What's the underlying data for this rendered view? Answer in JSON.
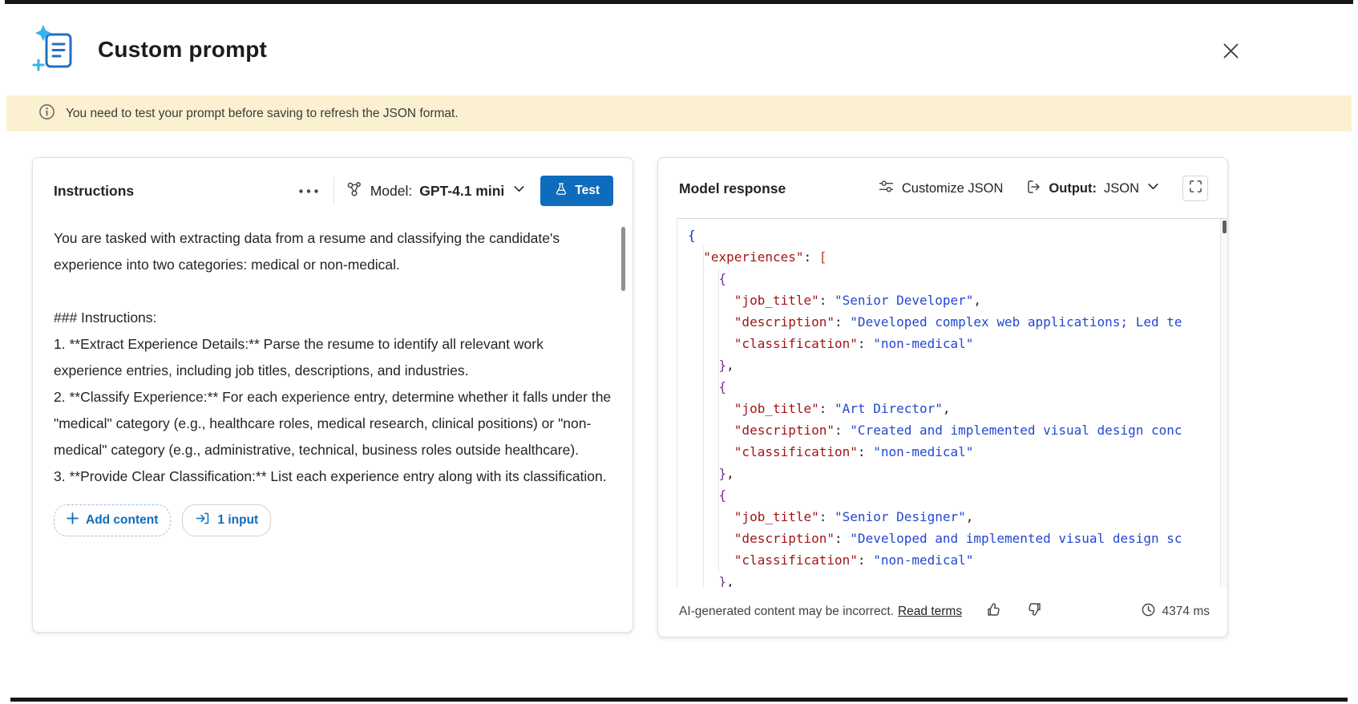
{
  "header": {
    "title": "Custom prompt"
  },
  "banner": {
    "message": "You need to test your prompt before saving to refresh the JSON format."
  },
  "instructions_panel": {
    "title": "Instructions",
    "model_label": "Model:",
    "model_value": "GPT-4.1 mini",
    "test_button_label": "Test",
    "body_text": "You are tasked with extracting data from a resume and classifying the candidate's experience into two categories: medical or non-medical.\n\n### Instructions:\n1. **Extract Experience Details:** Parse the resume to identify all relevant work experience entries, including job titles, descriptions, and industries.\n2. **Classify Experience:** For each experience entry, determine whether it falls under the \"medical\" category (e.g., healthcare roles, medical research, clinical positions) or \"non-medical\" category (e.g., administrative, technical, business roles outside healthcare).\n3. **Provide Clear Classification:** List each experience entry along with its classification.",
    "add_content_button": "Add content",
    "input_button": "1 input"
  },
  "response_panel": {
    "title": "Model response",
    "customize_json_label": "Customize JSON",
    "output_label": "Output:",
    "output_value": "JSON",
    "code_lines": [
      [
        {
          "t": "b1",
          "s": "{"
        }
      ],
      [
        {
          "t": "w",
          "s": "  "
        },
        {
          "t": "k",
          "s": "\"experiences\""
        },
        {
          "t": "w",
          "s": ": "
        },
        {
          "t": "b2",
          "s": "["
        }
      ],
      [
        {
          "t": "w",
          "s": "    "
        },
        {
          "t": "b3",
          "s": "{"
        }
      ],
      [
        {
          "t": "w",
          "s": "      "
        },
        {
          "t": "k",
          "s": "\"job_title\""
        },
        {
          "t": "w",
          "s": ": "
        },
        {
          "t": "s",
          "s": "\"Senior Developer\""
        },
        {
          "t": "w",
          "s": ","
        }
      ],
      [
        {
          "t": "w",
          "s": "      "
        },
        {
          "t": "k",
          "s": "\"description\""
        },
        {
          "t": "w",
          "s": ": "
        },
        {
          "t": "s",
          "s": "\"Developed complex web applications; Led te"
        }
      ],
      [
        {
          "t": "w",
          "s": "      "
        },
        {
          "t": "k",
          "s": "\"classification\""
        },
        {
          "t": "w",
          "s": ": "
        },
        {
          "t": "s",
          "s": "\"non-medical\""
        }
      ],
      [
        {
          "t": "w",
          "s": "    "
        },
        {
          "t": "b3",
          "s": "}"
        },
        {
          "t": "w",
          "s": ","
        }
      ],
      [
        {
          "t": "w",
          "s": "    "
        },
        {
          "t": "b3",
          "s": "{"
        }
      ],
      [
        {
          "t": "w",
          "s": "      "
        },
        {
          "t": "k",
          "s": "\"job_title\""
        },
        {
          "t": "w",
          "s": ": "
        },
        {
          "t": "s",
          "s": "\"Art Director\""
        },
        {
          "t": "w",
          "s": ","
        }
      ],
      [
        {
          "t": "w",
          "s": "      "
        },
        {
          "t": "k",
          "s": "\"description\""
        },
        {
          "t": "w",
          "s": ": "
        },
        {
          "t": "s",
          "s": "\"Created and implemented visual design conc"
        }
      ],
      [
        {
          "t": "w",
          "s": "      "
        },
        {
          "t": "k",
          "s": "\"classification\""
        },
        {
          "t": "w",
          "s": ": "
        },
        {
          "t": "s",
          "s": "\"non-medical\""
        }
      ],
      [
        {
          "t": "w",
          "s": "    "
        },
        {
          "t": "b3",
          "s": "}"
        },
        {
          "t": "w",
          "s": ","
        }
      ],
      [
        {
          "t": "w",
          "s": "    "
        },
        {
          "t": "b3",
          "s": "{"
        }
      ],
      [
        {
          "t": "w",
          "s": "      "
        },
        {
          "t": "k",
          "s": "\"job_title\""
        },
        {
          "t": "w",
          "s": ": "
        },
        {
          "t": "s",
          "s": "\"Senior Designer\""
        },
        {
          "t": "w",
          "s": ","
        }
      ],
      [
        {
          "t": "w",
          "s": "      "
        },
        {
          "t": "k",
          "s": "\"description\""
        },
        {
          "t": "w",
          "s": ": "
        },
        {
          "t": "s",
          "s": "\"Developed and implemented visual design sc"
        }
      ],
      [
        {
          "t": "w",
          "s": "      "
        },
        {
          "t": "k",
          "s": "\"classification\""
        },
        {
          "t": "w",
          "s": ": "
        },
        {
          "t": "s",
          "s": "\"non-medical\""
        }
      ],
      [
        {
          "t": "w",
          "s": "    "
        },
        {
          "t": "b3",
          "s": "}"
        },
        {
          "t": "w",
          "s": ","
        }
      ]
    ],
    "footer": {
      "disclaimer": "AI-generated content may be incorrect.",
      "read_terms_link": "Read terms",
      "latency": "4374 ms"
    }
  },
  "colors": {
    "accent": "#0f6cbd",
    "banner_bg": "#fbf1d1",
    "json_key": "#a31515",
    "json_string": "#2447cf",
    "bracket_level1": "#0431fa",
    "bracket_level2": "#c0392b",
    "bracket_level3": "#7b2d90"
  }
}
